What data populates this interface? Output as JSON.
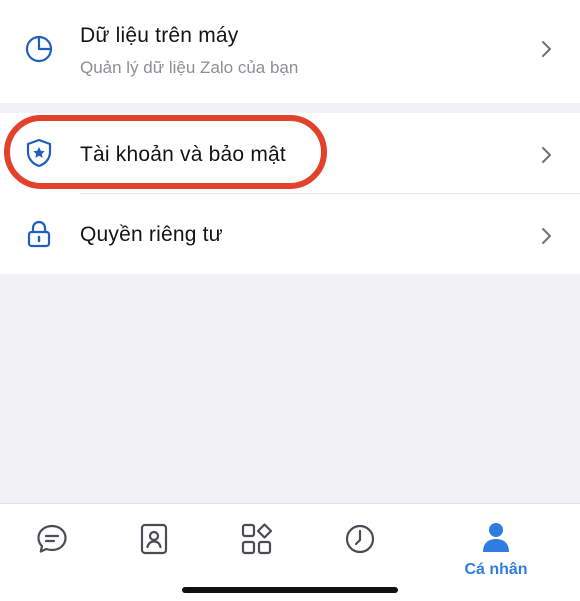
{
  "settings": {
    "device_data": {
      "title": "Dữ liệu trên máy",
      "subtitle": "Quản lý dữ liệu Zalo của bạn",
      "icon": "pie-chart-icon"
    },
    "account_security": {
      "title": "Tài khoản và bảo mật",
      "icon": "shield-star-icon",
      "highlighted": true
    },
    "privacy": {
      "title": "Quyền riêng tư",
      "icon": "lock-icon"
    }
  },
  "tabbar": {
    "tabs": [
      {
        "id": "messages",
        "icon": "chat-bubble-icon",
        "label": ""
      },
      {
        "id": "contacts",
        "icon": "contacts-icon",
        "label": ""
      },
      {
        "id": "discover",
        "icon": "apps-grid-icon",
        "label": ""
      },
      {
        "id": "timeline",
        "icon": "clock-icon",
        "label": ""
      },
      {
        "id": "profile",
        "icon": "person-icon",
        "label": "Cá nhân",
        "active": true
      }
    ]
  },
  "colors": {
    "accent": "#2f7de0",
    "icon_blue": "#1f5fbf",
    "highlight": "#e2422d",
    "background": "#f2f2f4"
  }
}
